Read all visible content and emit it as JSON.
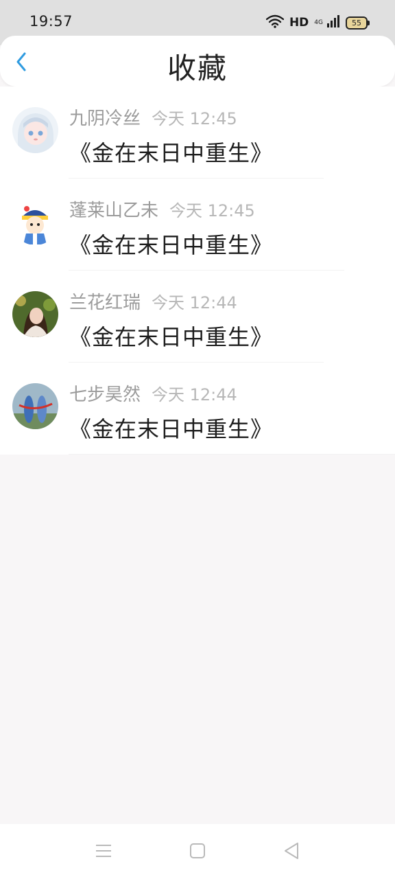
{
  "status_bar": {
    "time": "19:57",
    "hd": "HD",
    "network": "4G",
    "battery": "55",
    "icons": [
      "wifi-icon",
      "signal-icon",
      "battery-icon"
    ]
  },
  "header": {
    "title": "收藏",
    "back_icon": "chevron-left-icon"
  },
  "favorites": [
    {
      "name": "九阴冷丝",
      "time": "今天 12:45",
      "content": "《金在末日中重生》",
      "avatar": "avatar-anime-girl"
    },
    {
      "name": "蓬莱山乙未",
      "time": "今天 12:45",
      "content": "《金在末日中重生》",
      "avatar": "avatar-cartoon-official"
    },
    {
      "name": "兰花红瑞",
      "time": "今天 12:44",
      "content": "《金在末日中重生》",
      "avatar": "avatar-girl-photo"
    },
    {
      "name": "七步昊然",
      "time": "今天 12:44",
      "content": "《金在末日中重生》",
      "avatar": "avatar-blue-figures"
    }
  ],
  "nav_bar": {
    "icons": [
      "menu-icon",
      "home-square-icon",
      "back-triangle-icon"
    ]
  },
  "colors": {
    "accent": "#2f9be0",
    "name_gray": "#9b9b9b",
    "time_gray": "#b7b7b7",
    "page_bg": "#f8f6f7"
  }
}
